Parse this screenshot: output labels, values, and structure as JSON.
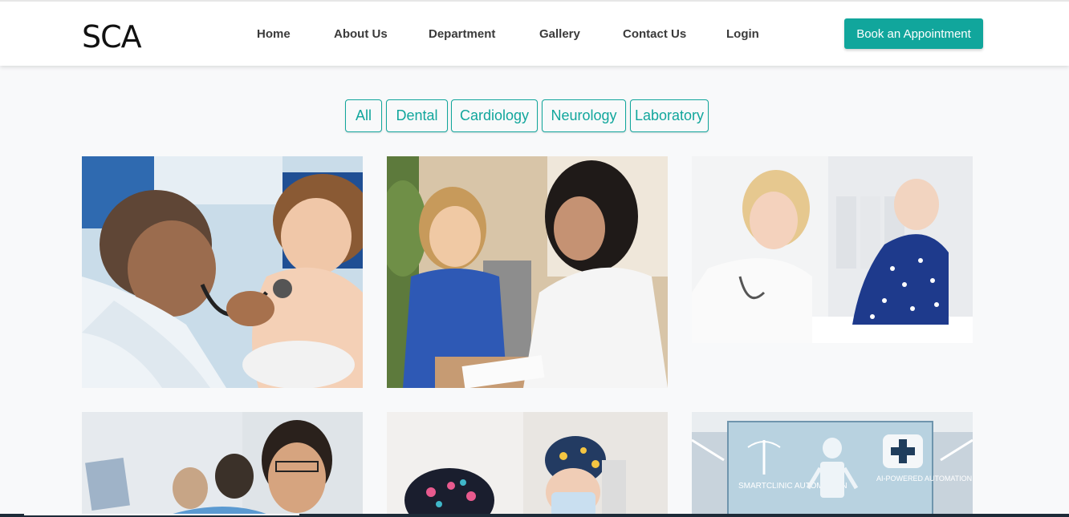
{
  "header": {
    "logo": "SCA",
    "nav": [
      "Home",
      "About Us",
      "Department",
      "Gallery",
      "Contact Us",
      "Login"
    ],
    "cta_label": "Book an Appointment"
  },
  "filters": [
    "All",
    "Dental",
    "Cardiology",
    "Neurology",
    "Laboratory"
  ],
  "gallery": {
    "ai_panel_left": "SMARTCLINIC AUTOMATION",
    "ai_panel_right": "AI-POWERED AUTOMATION SYSTEM"
  },
  "colors": {
    "accent": "#11a69c",
    "page_bg": "#f8f9fa",
    "nav_text": "#3a3a3a"
  }
}
